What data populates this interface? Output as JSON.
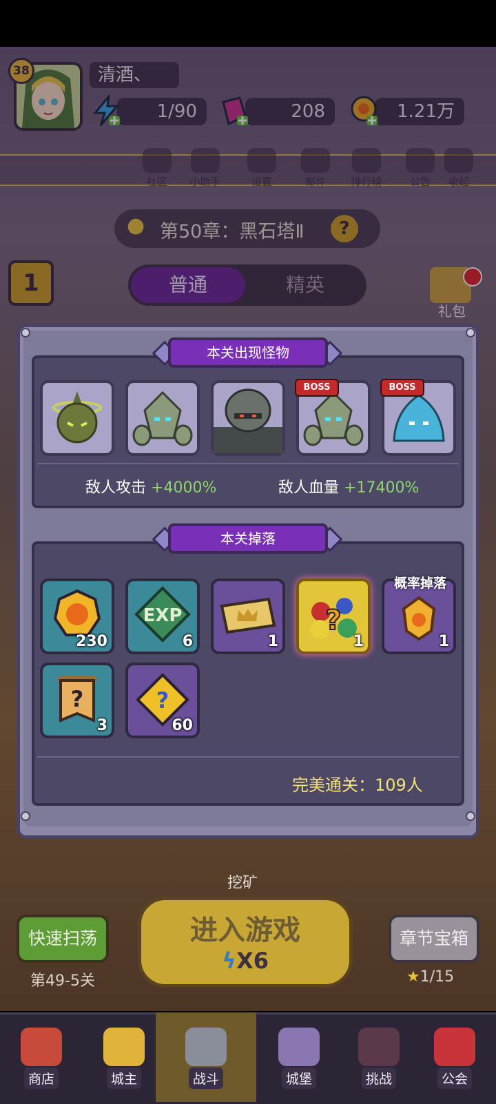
{
  "player": {
    "name": "清酒、",
    "level": "38"
  },
  "resources": {
    "energy": "1/90",
    "gems": "208",
    "gold": "1.21万"
  },
  "nav": [
    {
      "label": "社区",
      "icon": "home-icon"
    },
    {
      "label": "小助手",
      "icon": "robot-icon"
    },
    {
      "label": "设置",
      "icon": "gear-icon"
    },
    {
      "label": "邮件",
      "icon": "mail-icon"
    },
    {
      "label": "排行榜",
      "icon": "ranking-icon"
    },
    {
      "label": "公告",
      "icon": "announcement-icon"
    },
    {
      "label": "收起",
      "icon": "collapse-icon"
    }
  ],
  "chapter": {
    "title": "第50章：黑石塔Ⅱ"
  },
  "mode_tabs": {
    "normal": "普通",
    "elite": "精英"
  },
  "side": {
    "gift_label": "礼包"
  },
  "dialog": {
    "monsters_title": "本关出现怪物",
    "boss_tag": "BOSS",
    "monsters": [
      {
        "name": "halo-goblin",
        "boss": false
      },
      {
        "name": "stone-golem",
        "boss": false
      },
      {
        "name": "armored-knight",
        "boss": false
      },
      {
        "name": "stone-golem-boss",
        "boss": true
      },
      {
        "name": "water-elemental-boss",
        "boss": true
      }
    ],
    "enemy_attack_label": "敌人攻击",
    "enemy_attack_value": "+4000%",
    "enemy_hp_label": "敌人血量",
    "enemy_hp_value": "+17400%",
    "drops_title": "本关掉落",
    "drops": [
      {
        "icon": "gold-coin-icon",
        "count": "230",
        "tag": ""
      },
      {
        "icon": "exp-icon",
        "count": "6",
        "tag": ""
      },
      {
        "icon": "crown-ticket-icon",
        "count": "1",
        "tag": ""
      },
      {
        "icon": "mystery-gems-icon",
        "count": "1",
        "tag": ""
      },
      {
        "icon": "fire-crystal-icon",
        "count": "1",
        "tag": "概率掉落"
      },
      {
        "icon": "mystery-scroll-icon",
        "count": "3",
        "tag": ""
      },
      {
        "icon": "mystery-puzzle-icon",
        "count": "60",
        "tag": ""
      }
    ],
    "perfect_clear": "完美通关：109人"
  },
  "bottom": {
    "mine_label": "挖矿",
    "sweep_label": "快速扫荡",
    "sweep_sub": "第49-5关",
    "enter_label": "进入游戏",
    "enter_cost": "X6",
    "chest_label": "章节宝箱",
    "chest_progress": "1/15"
  },
  "tabbar": [
    {
      "label": "商店",
      "icon": "shop-icon"
    },
    {
      "label": "城主",
      "icon": "crown-icon"
    },
    {
      "label": "战斗",
      "icon": "crossed-swords-icon"
    },
    {
      "label": "城堡",
      "icon": "castle-icon"
    },
    {
      "label": "挑战",
      "icon": "demon-icon"
    },
    {
      "label": "公会",
      "icon": "guild-banner-icon"
    }
  ],
  "colors": {
    "accent_purple": "#7a2fb8",
    "stat_green": "#8fd66a",
    "gold_text": "#f2e27a"
  }
}
